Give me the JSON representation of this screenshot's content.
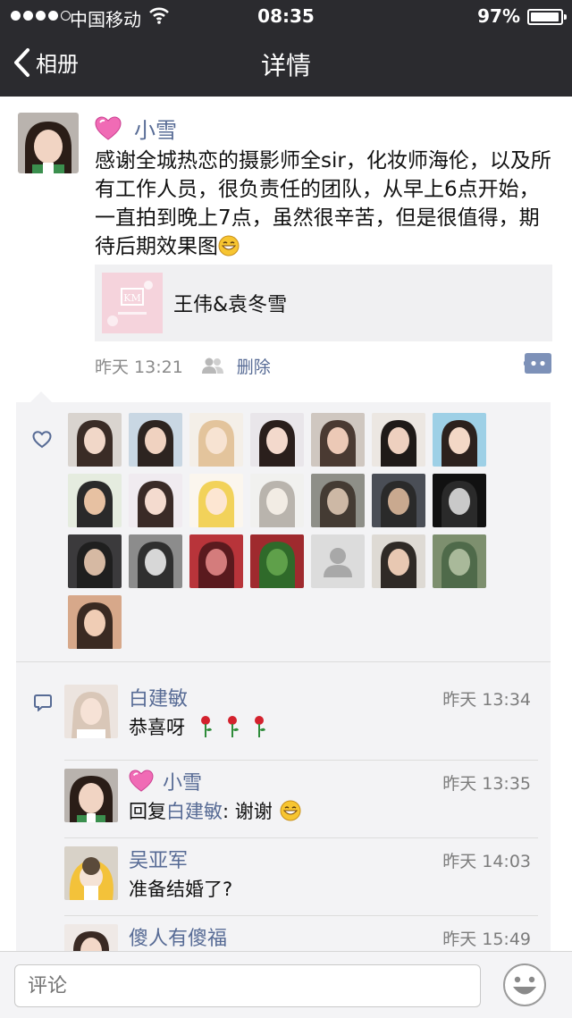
{
  "status": {
    "carrier": "中国移动",
    "time": "08:35",
    "battery": "97%",
    "battery_level": 0.97
  },
  "nav": {
    "back_label": "相册",
    "title": "详情"
  },
  "post": {
    "author": "小雪",
    "text": "感谢全城热恋的摄影师全sir，化妆师海伦，以及所有工作人员，很负责任的团队，从早上6点开始，一直拍到晚上7点，虽然很辛苦，但是很值得，期待后期效果图",
    "share_title": "王伟&袁冬雪",
    "time": "昨天 13:21",
    "delete_label": "删除"
  },
  "likes_count": 22,
  "comments": [
    {
      "name": "白建敏",
      "time": "昨天 13:34",
      "text": "恭喜呀",
      "heart": false
    },
    {
      "name": "小雪",
      "time": "昨天 13:35",
      "reply_prefix": "回复",
      "reply_to": "白建敏",
      "text": ": 谢谢",
      "heart": true
    },
    {
      "name": "吴亚军",
      "time": "昨天 14:03",
      "text": "准备结婚了?",
      "heart": false
    },
    {
      "name": "傻人有傻福",
      "time": "昨天 15:49",
      "text": "",
      "heart": false
    }
  ],
  "input": {
    "placeholder": "评论"
  },
  "colors": {
    "link": "#576b95",
    "nav_bg": "#2b2b2f",
    "panel_bg": "#f3f3f5"
  }
}
